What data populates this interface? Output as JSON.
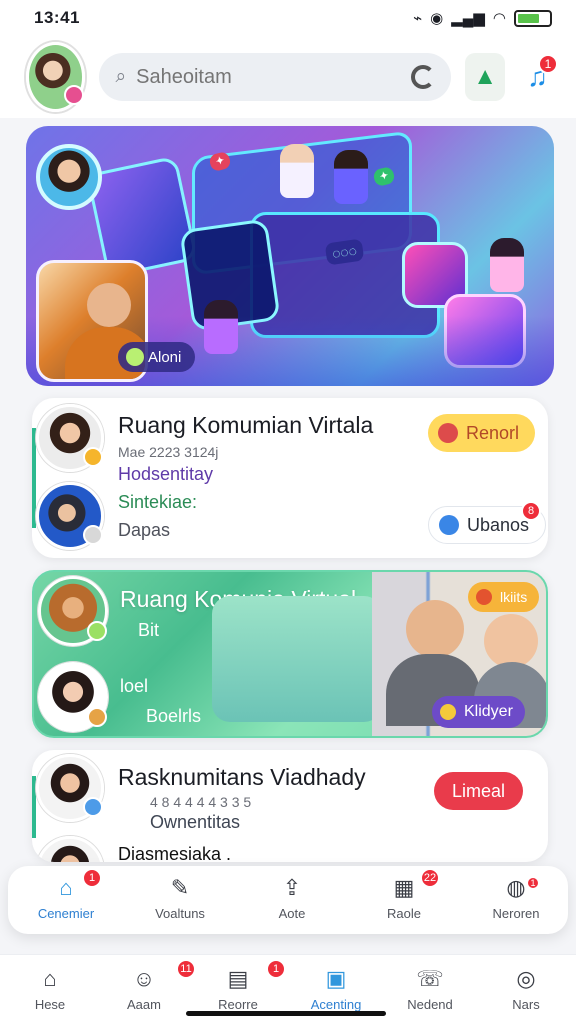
{
  "status_bar": {
    "time": "13:41",
    "bluetooth_icon": "bluetooth-icon",
    "location_icon": "location-icon",
    "signal_icon": "signal-icon",
    "wifi_icon": "wifi-icon",
    "battery_icon": "battery-icon",
    "battery_level_percent": 70
  },
  "header": {
    "profile_avatar": "avatar",
    "search_placeholder": "Saheoitam",
    "search_icon": "search-icon",
    "google_icon": "google-icon",
    "action_icon": "triangle-icon",
    "music_icon": "music-icon",
    "music_badge_count": "1"
  },
  "hero": {
    "label": "Aloni",
    "colors": {
      "primary": "#6f74e8",
      "secondary": "#a45ad9",
      "accent": "#6bc3e4"
    }
  },
  "cards": [
    {
      "title": "Ruang Komumian Virtala",
      "meta": "Mae 2223 3124j",
      "subtitle": "Hodsentitay",
      "tag": "Sintekiae:",
      "detail": "Dapas",
      "button_primary": "Renorl",
      "button_secondary": "Ubanos",
      "badge": "8"
    },
    {
      "title": "Ruang Komunia Virtual",
      "secondary_label": "Bit",
      "meta_left": "loel",
      "detail": "Boelrls",
      "button_top": "lkiits",
      "button_bottom": "Klidyer"
    },
    {
      "title": "Rasknumitans Viadhady",
      "meta": "4 8 4 4 4 4 3 3 5",
      "subtitle": "Ownentitas",
      "tail_text": "Diasmesiaka .",
      "button": "Limeal"
    }
  ],
  "bottom_tabs_1": [
    {
      "label": "Cenemier",
      "icon": "home-icon",
      "badge": "1"
    },
    {
      "label": "Voaltuns",
      "icon": "edit-icon",
      "badge": ""
    },
    {
      "label": "Aote",
      "icon": "upload-icon",
      "badge": ""
    },
    {
      "label": "Raole",
      "icon": "calendar-icon",
      "badge": "22"
    },
    {
      "label": "Neroren",
      "icon": "user-icon",
      "badge": "1"
    }
  ],
  "bottom_tabs_2": [
    {
      "label": "Hese",
      "icon": "house-icon",
      "badge": ""
    },
    {
      "label": "Aaam",
      "icon": "smile-icon",
      "badge": "11"
    },
    {
      "label": "Reorre",
      "icon": "table-icon",
      "badge": "1"
    },
    {
      "label": "Acenting",
      "icon": "folder-icon",
      "badge": ""
    },
    {
      "label": "Nedend",
      "icon": "chat-icon",
      "badge": ""
    },
    {
      "label": "Nars",
      "icon": "profile-icon",
      "badge": ""
    }
  ]
}
